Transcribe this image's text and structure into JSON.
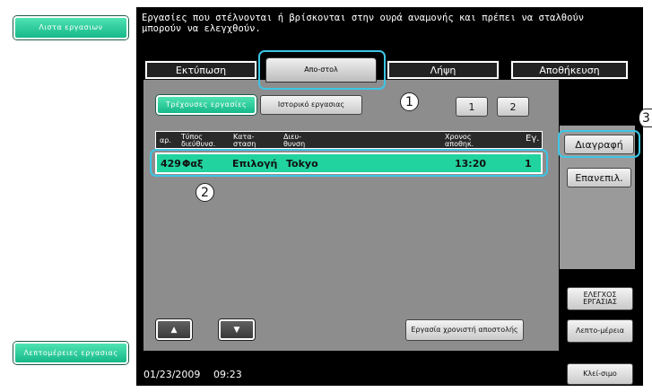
{
  "left": {
    "job_list_label": "Λιστα εργασιων",
    "job_details_label": "Λεπτομέρειες εργασιας"
  },
  "message": "Εργασίες που στέλνονται ή βρίσκονται στην ουρά αναμονής και πρέπει να σταλθούν μπορούν να ελεγχθούν.",
  "tabs": [
    "Εκτύπωση",
    "Απο-στολ",
    "Λήψη",
    "Αποθήκευση"
  ],
  "subtabs": {
    "current": "Τρέχουσες εργασίες",
    "history": "Ιστορικό εργασιας"
  },
  "pages": [
    "1",
    "2"
  ],
  "table": {
    "headers": [
      "αρ.",
      "Τύπος διεύθυνσ.",
      "Κατα-σταση",
      "Διευ-θυνση",
      "Χρονος αποθηκ.",
      "Εγ."
    ],
    "rows": [
      {
        "no": "429",
        "type": "Φαξ",
        "status": "Επιλογή",
        "address": "Tokyo",
        "time": "13:20",
        "copies": "1"
      }
    ]
  },
  "buttons": {
    "delete": "Διαγραφή",
    "resend": "Επανεπιλ.",
    "check_job": "ΕΛΕΓΧΟΣ ΕΡΓΑΣΙΑΣ",
    "details": "Λεπτο-μέρεια",
    "timer_job": "Εργασία χρονιστή αποστολής",
    "close": "Κλεί-σιμο",
    "up": "▲",
    "down": "▼"
  },
  "status": {
    "date": "01/23/2009",
    "time": "09:23"
  },
  "callouts": [
    "1",
    "2",
    "3"
  ]
}
